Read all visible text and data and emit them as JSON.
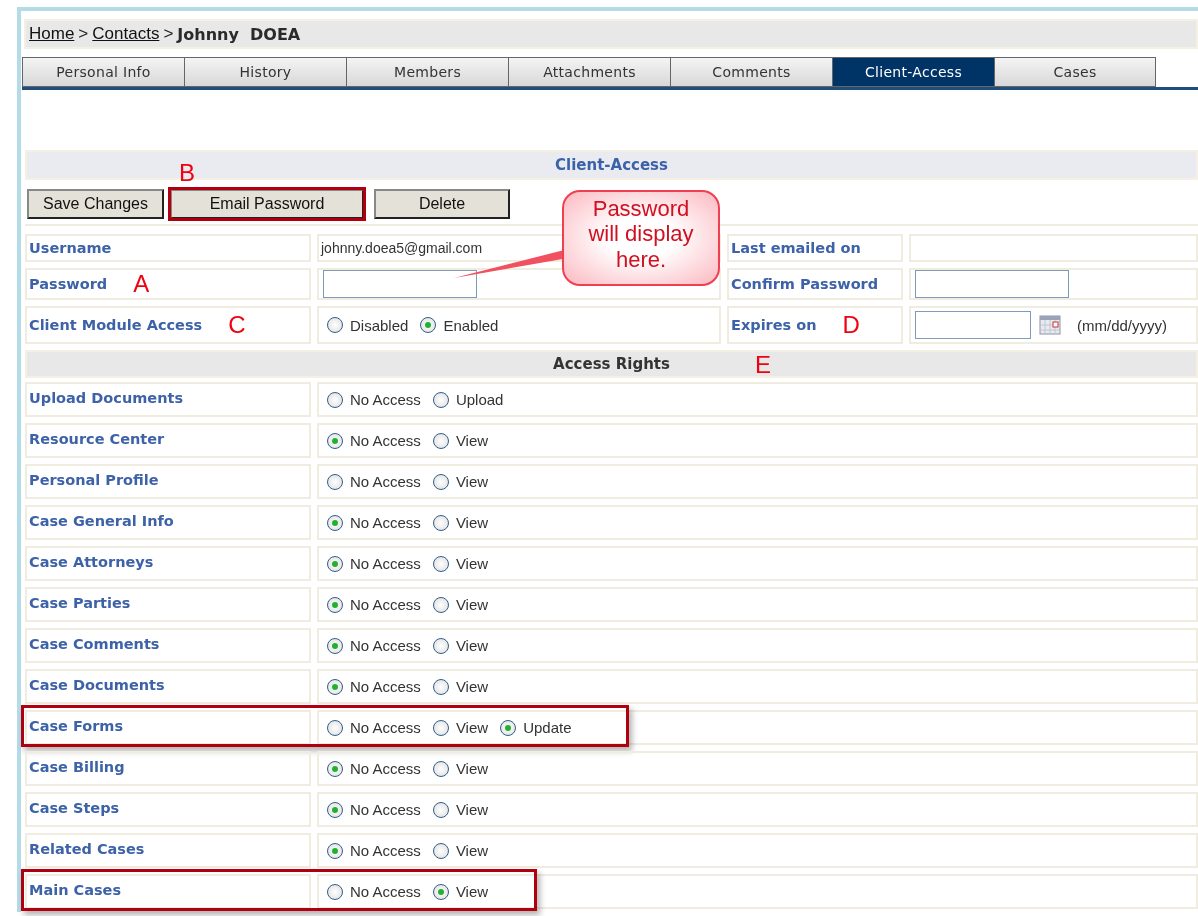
{
  "breadcrumb": {
    "separator": ">",
    "items": [
      {
        "label": "Home",
        "link": true
      },
      {
        "label": "Contacts",
        "link": true
      },
      {
        "label": "Johnny  DOEA",
        "link": false
      }
    ]
  },
  "tabs": [
    {
      "label": "Personal Info",
      "selected": false
    },
    {
      "label": "History",
      "selected": false
    },
    {
      "label": "Members",
      "selected": false
    },
    {
      "label": "Attachments",
      "selected": false
    },
    {
      "label": "Comments",
      "selected": false
    },
    {
      "label": "Client-Access",
      "selected": true
    },
    {
      "label": "Cases",
      "selected": false
    }
  ],
  "section_title": "Client-Access",
  "buttons": [
    {
      "label": "Save Changes",
      "highlighted": false
    },
    {
      "label": "Email Password",
      "highlighted": true,
      "marker": "B"
    },
    {
      "label": "Delete",
      "highlighted": false
    }
  ],
  "username": {
    "label": "Username",
    "value": "johnny.doea5@gmail.com"
  },
  "last_emailed": {
    "label": "Last emailed on"
  },
  "password": {
    "label": "Password",
    "marker": "A"
  },
  "confirm_password": {
    "label": "Confirm Password"
  },
  "client_module_access": {
    "label": "Client Module Access",
    "marker": "C",
    "options": [
      {
        "label": "Disabled",
        "selected": false
      },
      {
        "label": "Enabled",
        "selected": true
      }
    ]
  },
  "expires_on": {
    "label": "Expires on",
    "marker": "D",
    "hint": "(mm/dd/yyyy)"
  },
  "callout": {
    "text": "Password will display here."
  },
  "access_rights": {
    "title": "Access Rights",
    "marker": "E",
    "rows": [
      {
        "label": "Upload Documents",
        "highlighted": false,
        "options": [
          {
            "label": "No Access",
            "selected": false
          },
          {
            "label": "Upload",
            "selected": false
          }
        ]
      },
      {
        "label": "Resource Center",
        "highlighted": false,
        "options": [
          {
            "label": "No Access",
            "selected": true
          },
          {
            "label": "View",
            "selected": false
          }
        ]
      },
      {
        "label": "Personal Profile",
        "highlighted": false,
        "options": [
          {
            "label": "No Access",
            "selected": false
          },
          {
            "label": "View",
            "selected": false
          }
        ]
      },
      {
        "label": "Case General Info",
        "highlighted": false,
        "options": [
          {
            "label": "No Access",
            "selected": true
          },
          {
            "label": "View",
            "selected": false
          }
        ]
      },
      {
        "label": "Case Attorneys",
        "highlighted": false,
        "options": [
          {
            "label": "No Access",
            "selected": true
          },
          {
            "label": "View",
            "selected": false
          }
        ]
      },
      {
        "label": "Case Parties",
        "highlighted": false,
        "options": [
          {
            "label": "No Access",
            "selected": true
          },
          {
            "label": "View",
            "selected": false
          }
        ]
      },
      {
        "label": "Case Comments",
        "highlighted": false,
        "options": [
          {
            "label": "No Access",
            "selected": true
          },
          {
            "label": "View",
            "selected": false
          }
        ]
      },
      {
        "label": "Case Documents",
        "highlighted": false,
        "options": [
          {
            "label": "No Access",
            "selected": true
          },
          {
            "label": "View",
            "selected": false
          }
        ]
      },
      {
        "label": "Case Forms",
        "highlighted": true,
        "options": [
          {
            "label": "No Access",
            "selected": false
          },
          {
            "label": "View",
            "selected": false
          },
          {
            "label": "Update",
            "selected": true
          }
        ]
      },
      {
        "label": "Case Billing",
        "highlighted": false,
        "options": [
          {
            "label": "No Access",
            "selected": true
          },
          {
            "label": "View",
            "selected": false
          }
        ]
      },
      {
        "label": "Case Steps",
        "highlighted": false,
        "options": [
          {
            "label": "No Access",
            "selected": true
          },
          {
            "label": "View",
            "selected": false
          }
        ]
      },
      {
        "label": "Related Cases",
        "highlighted": false,
        "options": [
          {
            "label": "No Access",
            "selected": true
          },
          {
            "label": "View",
            "selected": false
          }
        ]
      },
      {
        "label": "Main Cases",
        "highlighted": true,
        "options": [
          {
            "label": "No Access",
            "selected": false
          },
          {
            "label": "View",
            "selected": true
          }
        ]
      }
    ]
  }
}
